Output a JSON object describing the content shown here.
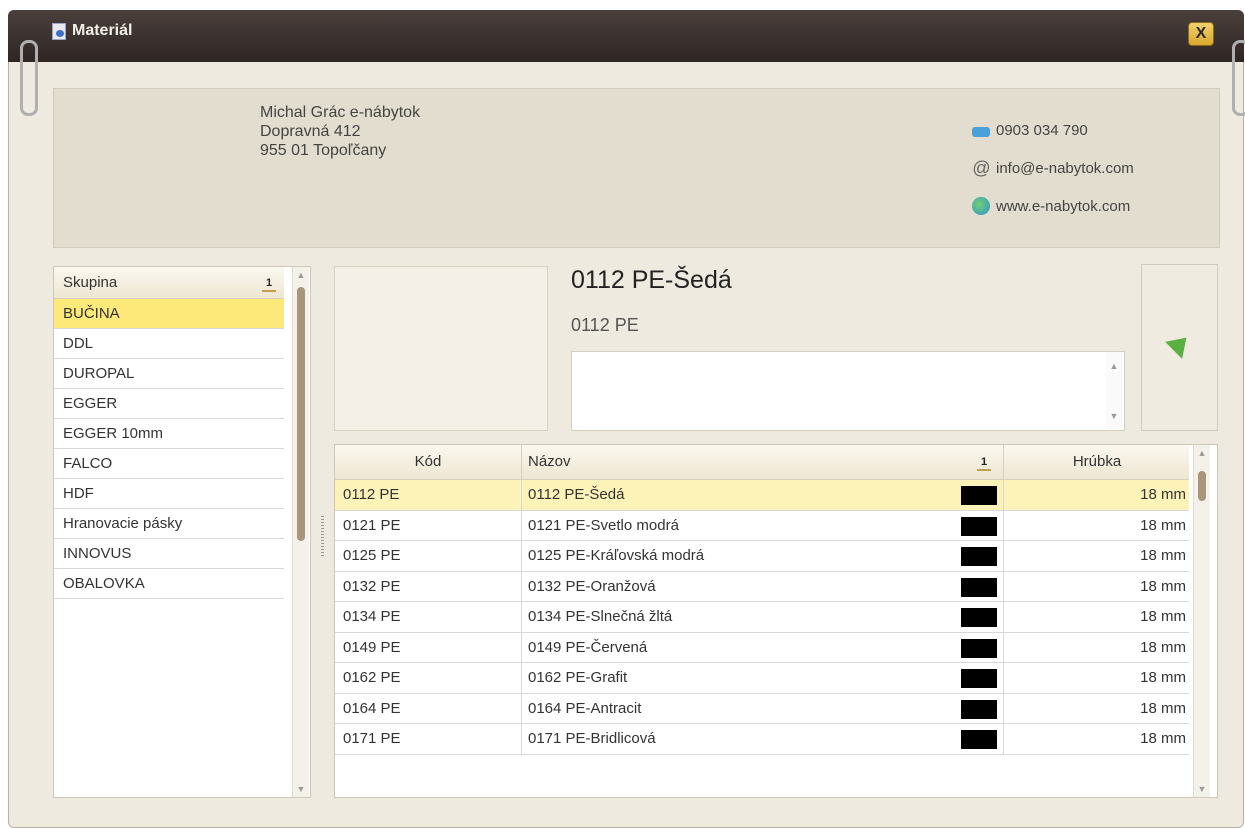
{
  "window": {
    "title": "Materiál",
    "close_label": "X"
  },
  "company": {
    "name": "Michal Grác e-nábytok",
    "street": "Dopravná 412",
    "city": "955 01  Topoľčany"
  },
  "contacts": {
    "phone": "0903 034 790",
    "email": "info@e-nabytok.com",
    "web": "www.e-nabytok.com"
  },
  "groups": {
    "header": "Skupina",
    "sort_glyph": "1",
    "items": [
      "BUČINA",
      "DDL",
      "DUROPAL",
      "EGGER",
      "EGGER 10mm",
      "FALCO",
      "HDF",
      "Hranovacie pásky",
      "INNOVUS",
      "OBALOVKA"
    ],
    "selected_index": 0
  },
  "detail": {
    "title": "0112 PE-Šedá",
    "code": "0112 PE",
    "description": ""
  },
  "table": {
    "columns": {
      "code": "Kód",
      "name": "Názov",
      "thickness": "Hrúbka",
      "sort_glyph": "1"
    },
    "rows": [
      {
        "code": "0112 PE",
        "name": "0112 PE-Šedá",
        "color": "#000000",
        "thickness": "18 mm",
        "selected": true
      },
      {
        "code": "0121 PE",
        "name": "0121 PE-Svetlo modrá",
        "color": "#000000",
        "thickness": "18 mm"
      },
      {
        "code": "0125 PE",
        "name": "0125 PE-Kráľovská modrá",
        "color": "#000000",
        "thickness": "18 mm"
      },
      {
        "code": "0132 PE",
        "name": "0132 PE-Oranžová",
        "color": "#000000",
        "thickness": "18 mm"
      },
      {
        "code": "0134 PE",
        "name": "0134 PE-Slnečná žltá",
        "color": "#000000",
        "thickness": "18 mm"
      },
      {
        "code": "0149 PE",
        "name": "0149 PE-Červená",
        "color": "#000000",
        "thickness": "18 mm"
      },
      {
        "code": "0162 PE",
        "name": "0162 PE-Grafit",
        "color": "#000000",
        "thickness": "18 mm"
      },
      {
        "code": "0164 PE",
        "name": "0164 PE-Antracit",
        "color": "#000000",
        "thickness": "18 mm"
      },
      {
        "code": "0171 PE",
        "name": "0171 PE-Bridlicová",
        "color": "#000000",
        "thickness": "18 mm"
      }
    ]
  },
  "colors": {
    "selected_group": "#fde97a",
    "selected_row": "#fdf3b8",
    "titlebar": "#3a302d",
    "accent_arrow": "#5ab040"
  },
  "icons": {
    "phone": "phone-icon",
    "email": "at-icon",
    "web": "globe-icon",
    "action": "arrow-icon"
  }
}
